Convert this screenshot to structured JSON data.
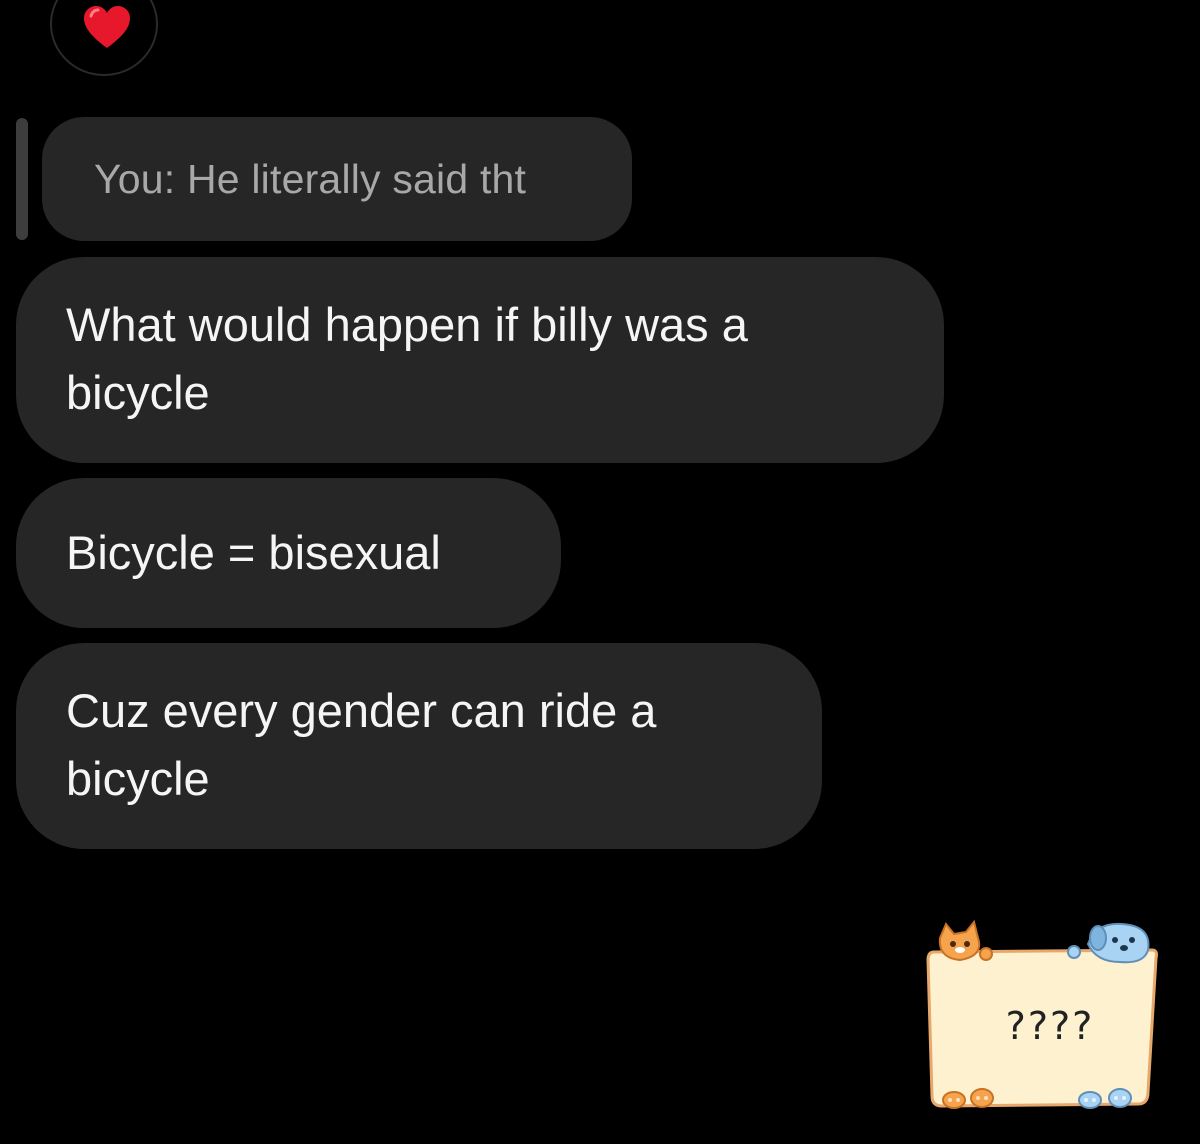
{
  "reaction": {
    "icon": "heart-icon",
    "color": "#e8182c"
  },
  "reply": {
    "text": "You: He literally said tht"
  },
  "messages": [
    {
      "text": "What would happen if billy was a bicycle"
    },
    {
      "text": "Bicycle = bisexual"
    },
    {
      "text": "Cuz every gender can ride a bicycle"
    }
  ],
  "sticker": {
    "text": "????"
  }
}
